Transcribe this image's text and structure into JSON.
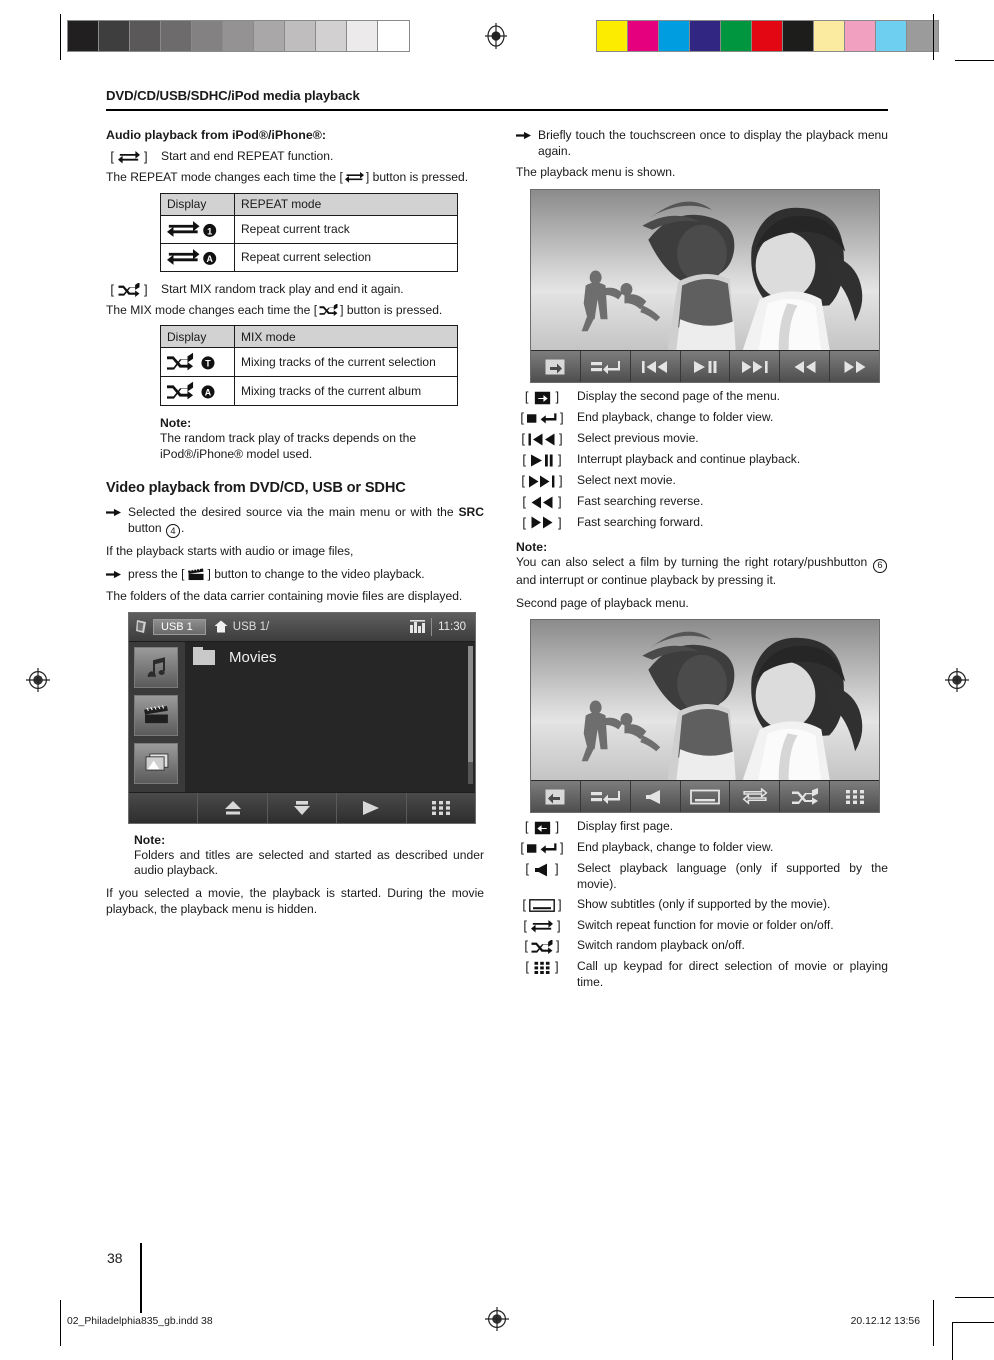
{
  "calibration": {
    "gray_swatches": [
      "#211f20",
      "#3f3e3e",
      "#5a5859",
      "#6d6b6c",
      "#838182",
      "#949293",
      "#a9a7a8",
      "#bfbdbe",
      "#d2d0d1",
      "#eceaeb",
      "#ffffff"
    ],
    "color_swatches": [
      "#fced00",
      "#e5007d",
      "#009ee0",
      "#312783",
      "#009640",
      "#e30613",
      "#1d1d1b",
      "#fbeba0",
      "#f2a0c0",
      "#6fcff1",
      "#9c9b9b"
    ]
  },
  "running_head": "DVD/CD/USB/SDHC/iPod media playback",
  "left": {
    "audio_heading": "Audio playback from iPod®/iPhone®:",
    "repeat": {
      "bracket_icon": "repeat-icon",
      "line1": "Start and end REPEAT function.",
      "line2_a": "The REPEAT mode changes each time the",
      "line2_b": "] button is pressed.",
      "table": {
        "headers": [
          "Display",
          "REPEAT mode"
        ],
        "rows": [
          {
            "icon": "repeat-one-icon",
            "badge": "1",
            "mode": "Repeat current track"
          },
          {
            "icon": "repeat-all-icon",
            "badge": "A",
            "mode": "Repeat current selection"
          }
        ]
      }
    },
    "mix": {
      "bracket_icon": "shuffle-icon",
      "line1": "Start MIX random track play and end it again.",
      "line2_a": "The MIX mode changes each time the",
      "line2_b": "] button is pressed.",
      "table": {
        "headers": [
          "Display",
          "MIX mode"
        ],
        "rows": [
          {
            "icon": "shuffle-title-icon",
            "badge": "T",
            "mode": "Mixing tracks of the current selection"
          },
          {
            "icon": "shuffle-album-icon",
            "badge": "A",
            "mode": "Mixing tracks of the current album"
          }
        ]
      }
    },
    "note1": {
      "label": "Note:",
      "text": "The random track play of tracks depends on the iPod®/iPhone® model used."
    },
    "video_heading": "Video playback from DVD/CD, USB or SDHC",
    "step1_a": "Selected the desired source via the main menu or with the",
    "step1_src": "SRC",
    "step1_b": "button",
    "step1_keynum": "4",
    "step1_c": ".",
    "para_if": "If the playback starts with audio or image files,",
    "step2_a": "press the [",
    "step2_icon": "movie-clapper-icon",
    "step2_b": "] button to change to the video playback.",
    "folders_text": "The folders of the data carrier containing movie files are displayed.",
    "screenshot": {
      "source_tag": "USB 1",
      "home_icon": "home-icon",
      "path": "USB 1/",
      "eq_icon": "equalizer-icon",
      "clock": "11:30",
      "rail_icons": [
        "music-note-icon",
        "movie-clapper-icon",
        "picture-icon"
      ],
      "list_items": [
        "Movies"
      ],
      "bottom_icons": [
        "blank-icon",
        "up-eject-icon",
        "down-icon",
        "play-icon",
        "keypad-icon"
      ]
    },
    "note2": {
      "label": "Note:",
      "text": "Folders and titles are selected and started as described under audio playback."
    },
    "para_movie": "If you selected a movie, the playback is started. During the movie playback, the playback menu is hidden."
  },
  "right": {
    "step_touch": "Briefly touch the touchscreen once to display the playback menu again.",
    "menu_shown": "The playback menu is shown.",
    "shot1": {
      "toolbar_icons": [
        "next-page-icon",
        "stop-return-icon",
        "prev-track-icon",
        "play-pause-icon",
        "next-track-icon",
        "rewind-icon",
        "fastforward-icon"
      ]
    },
    "list1": [
      {
        "icon": "next-page-icon",
        "text": "Display the second page of the menu."
      },
      {
        "icon": "stop-return-icon",
        "text": "End playback, change to folder view."
      },
      {
        "icon": "prev-track-icon",
        "text": "Select previous movie."
      },
      {
        "icon": "play-pause-icon",
        "text": "Interrupt playback and continue playback."
      },
      {
        "icon": "next-track-icon",
        "text": "Select next movie."
      },
      {
        "icon": "rewind-icon",
        "text": "Fast searching reverse."
      },
      {
        "icon": "fastforward-icon",
        "text": "Fast searching forward."
      }
    ],
    "note": {
      "label": "Note:",
      "text_a": "You can also select a film by turning the right rotary/pushbutton",
      "keynum": "6",
      "text_b": "and interrupt or continue playback by pressing it."
    },
    "second_page_caption": "Second page of playback menu.",
    "shot2": {
      "toolbar_icons": [
        "prev-page-icon",
        "stop-return-icon",
        "audio-language-icon",
        "subtitle-icon",
        "repeat-icon",
        "shuffle-icon",
        "keypad-icon"
      ]
    },
    "list2": [
      {
        "icon": "prev-page-icon",
        "text": "Display first page."
      },
      {
        "icon": "stop-return-icon",
        "text": "End playback, change to folder view."
      },
      {
        "icon": "audio-language-icon",
        "text": "Select playback language (only if supported by the movie)."
      },
      {
        "icon": "subtitle-icon",
        "text": "Show subtitles (only if supported by the movie)."
      },
      {
        "icon": "repeat-icon",
        "text": "Switch repeat function for movie or folder on/off."
      },
      {
        "icon": "shuffle-icon",
        "text": "Switch random playback on/off."
      },
      {
        "icon": "keypad-icon",
        "text": "Call up keypad for direct selection of movie or playing time."
      }
    ]
  },
  "footer": {
    "page_number": "38",
    "imprint_file": "02_Philadelphia835_gb.indd   38",
    "imprint_date": "20.12.12   13:56"
  }
}
